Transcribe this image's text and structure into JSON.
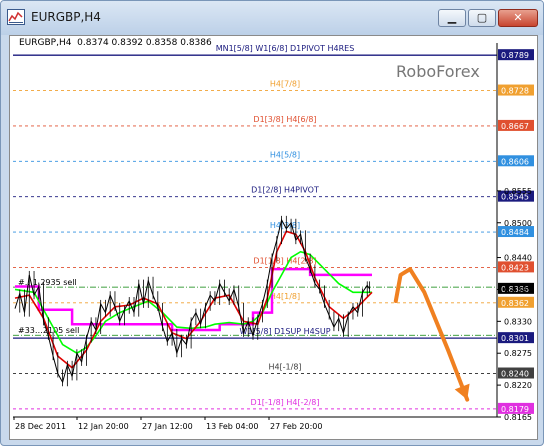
{
  "window": {
    "title": "EURGBP,H4",
    "minimize_glyph": "▁",
    "maximize_glyph": "▢",
    "close_glyph": "✕"
  },
  "header": {
    "info": "EURGBP,H4  0.8374 0.8392 0.8358 0.8386",
    "brand": "RoboForex"
  },
  "chart_data": {
    "type": "line",
    "symbol": "EURGBP",
    "timeframe": "H4",
    "ohlc": {
      "open": 0.8374,
      "high": 0.8392,
      "low": 0.8358,
      "close": 0.8386
    },
    "ylim": [
      0.8165,
      0.881
    ],
    "y_ticks": [
      0.8555,
      0.85,
      0.844,
      0.8385,
      0.833,
      0.8275,
      0.822,
      0.8165
    ],
    "x_ticks": [
      "28 Dec 2011",
      "12 Jan 20:00",
      "27 Jan 12:00",
      "13 Feb 04:00",
      "27 Feb 20:00"
    ],
    "levels": [
      {
        "label": "MN1[5/8] W1[6/8] D1PIVOT H4RES",
        "value": 0.8789,
        "color": "#1a1a7e",
        "style": "solid"
      },
      {
        "label": "H4[7/8]",
        "value": 0.8728,
        "color": "#f0a030",
        "style": "dash"
      },
      {
        "label": "D1[3/8] H4[6/8]",
        "value": 0.8667,
        "color": "#e05030",
        "style": "dash"
      },
      {
        "label": "H4[5/8]",
        "value": 0.8606,
        "color": "#3090e0",
        "style": "dash"
      },
      {
        "label": "D1[2/8] H4PIVOT",
        "value": 0.8545,
        "color": "#1a1a7e",
        "style": "dash"
      },
      {
        "label": "H4[3/8]",
        "value": 0.8484,
        "color": "#3090e0",
        "style": "dash"
      },
      {
        "label": "D1[1/8] H4[2/8]",
        "value": 0.8423,
        "color": "#e05030",
        "style": "dash"
      },
      {
        "label": "H4[1/8]",
        "value": 0.8362,
        "color": "#f0a030",
        "style": "dash"
      },
      {
        "label": "W1[5/8] D1SUP H4SUP",
        "value": 0.8301,
        "color": "#1a1a7e",
        "style": "solid"
      },
      {
        "label": "H4[-1/8]",
        "value": 0.824,
        "color": "#404040",
        "style": "dash"
      },
      {
        "label": "D1[-1/8] H4[-2/8]",
        "value": 0.8179,
        "color": "#e030e0",
        "style": "dash"
      }
    ],
    "current_price": {
      "value": 0.8386,
      "color": "#000000"
    },
    "order_labels": [
      {
        "label": "#…1.2935 sell",
        "value": 0.8389
      },
      {
        "label": "#33…2105 sell",
        "value": 0.8306
      }
    ],
    "price_series": {
      "name": "EURGBP,H4",
      "points": [
        [
          0,
          0.8352
        ],
        [
          2,
          0.8378
        ],
        [
          4,
          0.8345
        ],
        [
          6,
          0.841
        ],
        [
          8,
          0.8375
        ],
        [
          10,
          0.839
        ],
        [
          12,
          0.833
        ],
        [
          14,
          0.8305
        ],
        [
          16,
          0.827
        ],
        [
          18,
          0.824
        ],
        [
          20,
          0.8225
        ],
        [
          22,
          0.8255
        ],
        [
          24,
          0.8235
        ],
        [
          26,
          0.8275
        ],
        [
          28,
          0.826
        ],
        [
          30,
          0.83
        ],
        [
          32,
          0.833
        ],
        [
          34,
          0.8315
        ],
        [
          36,
          0.836
        ],
        [
          38,
          0.8345
        ],
        [
          40,
          0.8375
        ],
        [
          42,
          0.8355
        ],
        [
          44,
          0.833
        ],
        [
          46,
          0.835
        ],
        [
          48,
          0.8365
        ],
        [
          50,
          0.8345
        ],
        [
          52,
          0.8395
        ],
        [
          54,
          0.836
        ],
        [
          56,
          0.84
        ],
        [
          58,
          0.8375
        ],
        [
          60,
          0.8355
        ],
        [
          62,
          0.832
        ],
        [
          64,
          0.8295
        ],
        [
          66,
          0.831
        ],
        [
          68,
          0.8275
        ],
        [
          70,
          0.83
        ],
        [
          72,
          0.829
        ],
        [
          74,
          0.833
        ],
        [
          76,
          0.8345
        ],
        [
          78,
          0.8325
        ],
        [
          80,
          0.8355
        ],
        [
          82,
          0.8375
        ],
        [
          84,
          0.8365
        ],
        [
          86,
          0.8395
        ],
        [
          88,
          0.838
        ],
        [
          90,
          0.8365
        ],
        [
          92,
          0.8385
        ],
        [
          94,
          0.8355
        ],
        [
          96,
          0.831
        ],
        [
          98,
          0.833
        ],
        [
          100,
          0.8305
        ],
        [
          102,
          0.8335
        ],
        [
          104,
          0.836
        ],
        [
          106,
          0.8395
        ],
        [
          108,
          0.844
        ],
        [
          110,
          0.847
        ],
        [
          112,
          0.8505
        ],
        [
          114,
          0.849
        ],
        [
          116,
          0.85
        ],
        [
          118,
          0.847
        ],
        [
          120,
          0.848
        ],
        [
          122,
          0.844
        ],
        [
          124,
          0.842
        ],
        [
          126,
          0.8395
        ],
        [
          128,
          0.8385
        ],
        [
          130,
          0.836
        ],
        [
          132,
          0.834
        ],
        [
          134,
          0.832
        ],
        [
          136,
          0.8335
        ],
        [
          138,
          0.831
        ],
        [
          140,
          0.834
        ],
        [
          142,
          0.8355
        ],
        [
          144,
          0.8345
        ],
        [
          146,
          0.838
        ],
        [
          148,
          0.8392
        ],
        [
          149,
          0.8386
        ]
      ]
    },
    "ma_series": [
      {
        "color": "#ff00ff",
        "points": [
          [
            0,
            0.839
          ],
          [
            10,
            0.839
          ],
          [
            10,
            0.835
          ],
          [
            24,
            0.835
          ],
          [
            24,
            0.8325
          ],
          [
            66,
            0.8325
          ],
          [
            66,
            0.8315
          ],
          [
            86,
            0.8315
          ],
          [
            86,
            0.8325
          ],
          [
            100,
            0.8325
          ],
          [
            100,
            0.8345
          ],
          [
            108,
            0.8345
          ],
          [
            108,
            0.842
          ],
          [
            124,
            0.842
          ],
          [
            124,
            0.841
          ],
          [
            150,
            0.841
          ]
        ]
      },
      {
        "color": "#00ff00",
        "points": [
          [
            0,
            0.8385
          ],
          [
            8,
            0.838
          ],
          [
            14,
            0.8335
          ],
          [
            20,
            0.829
          ],
          [
            26,
            0.8275
          ],
          [
            30,
            0.8285
          ],
          [
            34,
            0.8305
          ],
          [
            38,
            0.833
          ],
          [
            44,
            0.8345
          ],
          [
            50,
            0.8355
          ],
          [
            56,
            0.8365
          ],
          [
            62,
            0.8345
          ],
          [
            68,
            0.832
          ],
          [
            74,
            0.8318
          ],
          [
            80,
            0.832
          ],
          [
            84,
            0.8325
          ],
          [
            90,
            0.8328
          ],
          [
            96,
            0.8325
          ],
          [
            100,
            0.833
          ],
          [
            104,
            0.8345
          ],
          [
            108,
            0.838
          ],
          [
            112,
            0.841
          ],
          [
            116,
            0.844
          ],
          [
            120,
            0.845
          ],
          [
            124,
            0.8445
          ],
          [
            130,
            0.842
          ],
          [
            136,
            0.8395
          ],
          [
            142,
            0.838
          ],
          [
            150,
            0.838
          ]
        ]
      },
      {
        "color": "#e00000",
        "points": [
          [
            0,
            0.837
          ],
          [
            6,
            0.8375
          ],
          [
            12,
            0.8335
          ],
          [
            18,
            0.827
          ],
          [
            24,
            0.825
          ],
          [
            30,
            0.828
          ],
          [
            36,
            0.833
          ],
          [
            42,
            0.8355
          ],
          [
            48,
            0.8358
          ],
          [
            54,
            0.837
          ],
          [
            60,
            0.836
          ],
          [
            66,
            0.831
          ],
          [
            72,
            0.83
          ],
          [
            78,
            0.833
          ],
          [
            84,
            0.837
          ],
          [
            90,
            0.8375
          ],
          [
            96,
            0.833
          ],
          [
            102,
            0.8325
          ],
          [
            106,
            0.837
          ],
          [
            110,
            0.845
          ],
          [
            114,
            0.8485
          ],
          [
            118,
            0.848
          ],
          [
            122,
            0.845
          ],
          [
            126,
            0.8405
          ],
          [
            132,
            0.8355
          ],
          [
            138,
            0.8335
          ],
          [
            144,
            0.8355
          ],
          [
            150,
            0.838
          ]
        ]
      }
    ],
    "forecast_arrow": {
      "color": "#f08020",
      "points": [
        [
          160,
          0.8365
        ],
        [
          162,
          0.841
        ],
        [
          166,
          0.842
        ],
        [
          172,
          0.838
        ],
        [
          182,
          0.828
        ],
        [
          190,
          0.8195
        ]
      ]
    }
  }
}
